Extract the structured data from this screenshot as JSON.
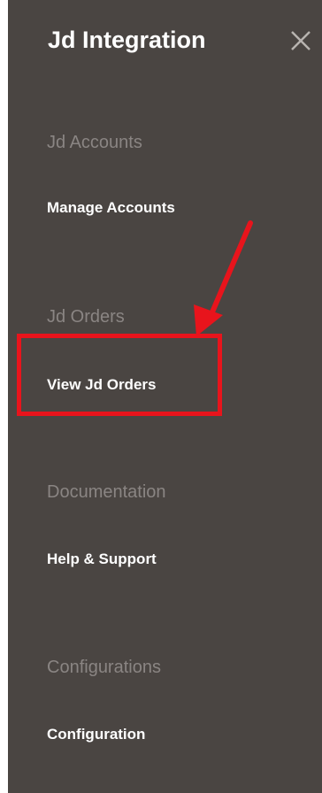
{
  "panel": {
    "title": "Jd Integration",
    "close_icon": "close-icon"
  },
  "sections": [
    {
      "heading": "Jd Accounts",
      "link": "Manage Accounts"
    },
    {
      "heading": "Jd Orders",
      "link": "View Jd Orders"
    },
    {
      "heading": "Documentation",
      "link": "Help & Support"
    },
    {
      "heading": "Configurations",
      "link": "Configuration"
    }
  ],
  "annotation": {
    "color": "#e8141c",
    "arrow_icon": "red-arrow-icon"
  }
}
